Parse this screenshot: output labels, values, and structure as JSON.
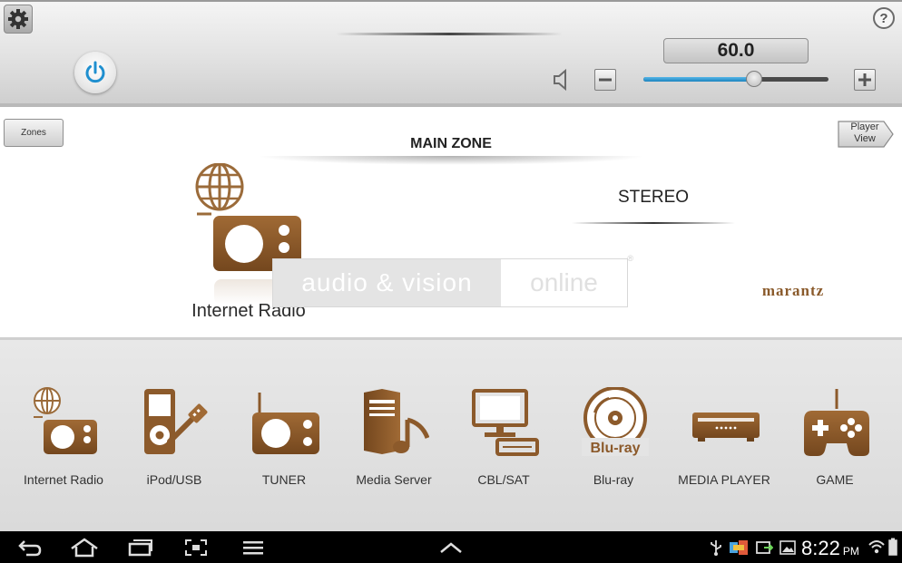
{
  "header": {
    "volume_value": "60.0",
    "volume_level": 0.6,
    "help_label": "?"
  },
  "zone": {
    "zones_label": "Zones",
    "player_view_label": "Player View",
    "title": "MAIN ZONE",
    "current_source": "Internet Radio",
    "sound_mode": "STEREO"
  },
  "watermark": {
    "left_text": "audio & vision",
    "right_text": "online",
    "mark": "®"
  },
  "brand": "marantz",
  "sources": [
    {
      "label": "Internet Radio",
      "icon": "internet-radio-icon"
    },
    {
      "label": "iPod/USB",
      "icon": "ipod-usb-icon"
    },
    {
      "label": "TUNER",
      "icon": "tuner-icon"
    },
    {
      "label": "Media Server",
      "icon": "media-server-icon"
    },
    {
      "label": "CBL/SAT",
      "icon": "cbl-sat-icon"
    },
    {
      "label": "Blu-ray",
      "icon": "blu-ray-icon",
      "icon_text": "Blu-ray"
    },
    {
      "label": "MEDIA PLAYER",
      "icon": "media-player-icon"
    },
    {
      "label": "GAME",
      "icon": "game-icon"
    }
  ],
  "statusbar": {
    "time": "8:22",
    "ampm": "PM"
  },
  "colors": {
    "icon_brown": "#8a5a2b",
    "accent_blue": "#1d84bf",
    "nav_bg": "#000000"
  }
}
